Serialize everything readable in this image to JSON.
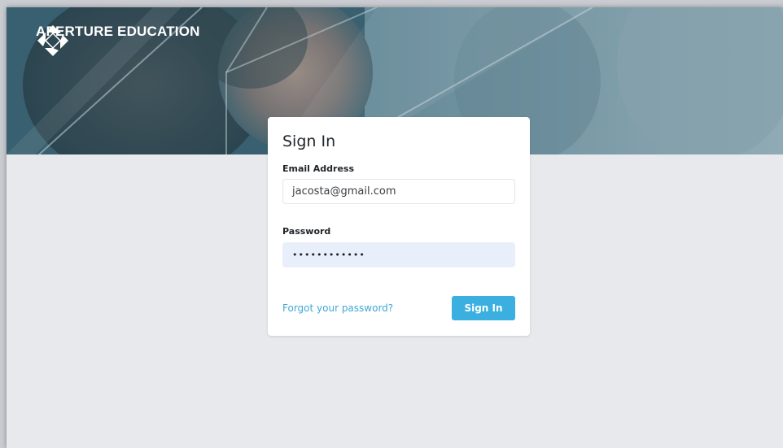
{
  "brand": {
    "name": "APERTURE EDUCATION",
    "logo_icon": "aperture-logo-icon"
  },
  "signin": {
    "title": "Sign In",
    "email_label": "Email Address",
    "email_value": "jacosta@gmail.com",
    "password_label": "Password",
    "password_value": "••••••••••••",
    "forgot_link": "Forgot your password?",
    "submit_label": "Sign In"
  },
  "colors": {
    "accent": "#3aafe0",
    "link": "#3fa9d6",
    "page_background": "#e8e9ec",
    "password_fill": "#e8effb"
  }
}
